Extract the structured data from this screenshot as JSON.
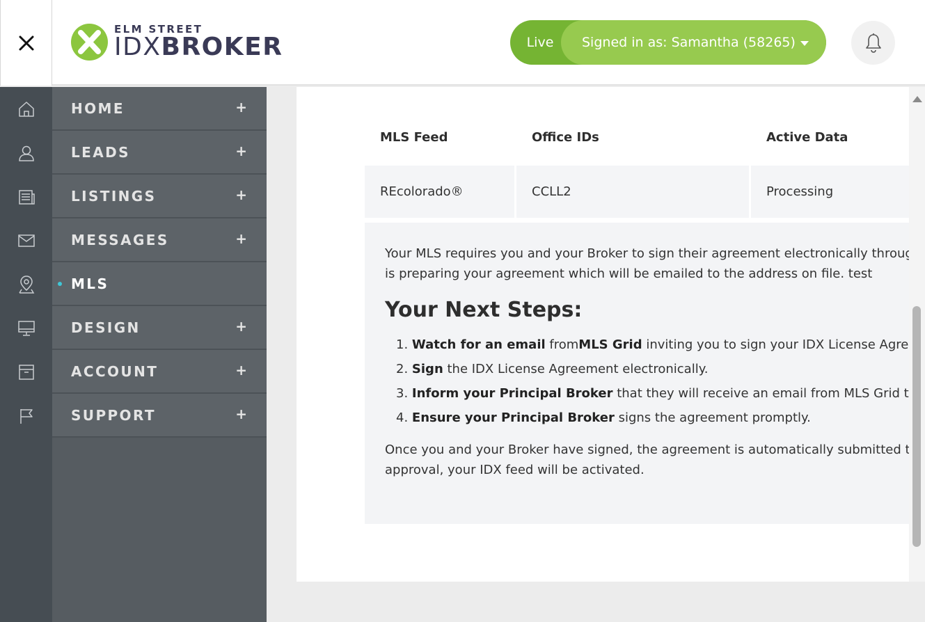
{
  "header": {
    "logo_top": "ELM STREET",
    "logo_idx": "IDX",
    "logo_broker": "BROKER",
    "live_label": "Live",
    "signed_in_label": "Signed in as: Samantha (58265)",
    "accent_color": "#8cc63f"
  },
  "rail_icons": [
    "home-icon",
    "user-icon",
    "listings-icon",
    "mail-icon",
    "map-pin-icon",
    "monitor-icon",
    "archive-icon",
    "flag-icon"
  ],
  "nav": {
    "items": [
      {
        "label": "HOME",
        "expand": "+"
      },
      {
        "label": "LEADS",
        "expand": "+"
      },
      {
        "label": "LISTINGS",
        "expand": "+"
      },
      {
        "label": "MESSAGES",
        "expand": "+"
      },
      {
        "label": "MLS",
        "active": true
      },
      {
        "label": "DESIGN",
        "expand": "+"
      },
      {
        "label": "ACCOUNT",
        "expand": "+"
      },
      {
        "label": "SUPPORT",
        "expand": "+"
      }
    ]
  },
  "table": {
    "headers": [
      "MLS Feed",
      "Office IDs",
      "Active Data"
    ],
    "rows": [
      [
        "REcolorado®",
        "CCLL2",
        "Processing"
      ]
    ]
  },
  "info": {
    "intro_line1": "Your MLS requires you and your Broker to sign their agreement electronically through MLS Grid. MLS Grid",
    "intro_line2": "is preparing your agreement which will be emailed to the address on file. test",
    "steps_title": "Your Next Steps:",
    "steps": [
      {
        "num": "1.",
        "bold": "Watch for an email",
        "mid": " from",
        "bold2": "MLS Grid",
        "rest": " inviting you to sign your IDX License Agreement."
      },
      {
        "num": "2.",
        "bold": "Sign",
        "rest": " the IDX License Agreement electronically."
      },
      {
        "num": "3.",
        "bold": "Inform your Principal Broker",
        "rest": " that they will receive an email from MLS Grid to sign."
      },
      {
        "num": "4.",
        "bold": "Ensure your Principal Broker",
        "rest": " signs the agreement promptly."
      }
    ],
    "outro_line1": "Once you and your Broker have signed, the agreement is automatically submitted to your MLS. Upon",
    "outro_line2": "approval, your IDX feed will be activated."
  }
}
